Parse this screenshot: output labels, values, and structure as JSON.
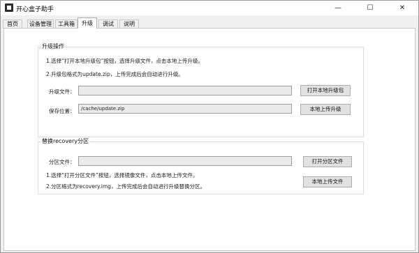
{
  "window": {
    "title": "开心盒子助手",
    "minimize_glyph": "—",
    "maximize_glyph": "☐",
    "close_glyph": "✕"
  },
  "tabs": [
    {
      "label": "首页"
    },
    {
      "label": "设备管理"
    },
    {
      "label": "工具箱"
    },
    {
      "label": "升级",
      "active": true
    },
    {
      "label": "调试"
    },
    {
      "label": "说明"
    }
  ],
  "upgrade": {
    "group_title": "升级操作",
    "instruction1": "1.选择“打开本地升级包”按钮，选择升级文件，点击本地上传升级。",
    "instruction2": "2.升级包格式为update.zip，上传完成后会自动进行升级。",
    "file_label": "升级文件：",
    "file_value": "",
    "open_button": "打开本地升级包",
    "save_label": "保存位置：",
    "save_value": "/cache/update.zip",
    "upload_button": "本地上传升级"
  },
  "recovery": {
    "group_title": "替换recovery分区",
    "file_label": "分区文件：",
    "file_value": "",
    "open_button": "打开分区文件",
    "instruction1": "1.选择“打开分区文件”按钮，选择镜像文件，点击本地上传文件。",
    "instruction2": "2.分区格式为recovery.img，上传完成后会自动进行升级替换分区。",
    "upload_button": "本地上传文件"
  },
  "colors": {
    "accent_border": "#adadad",
    "button_bg": "#e1e1e1",
    "field_bg": "#eaeaea"
  }
}
